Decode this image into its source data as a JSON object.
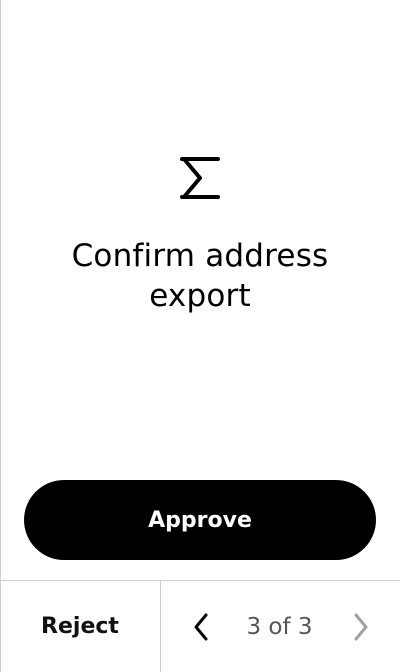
{
  "screen": {
    "app_icon": "sigma-icon",
    "title": "Confirm address export"
  },
  "actions": {
    "approve_label": "Approve"
  },
  "footer": {
    "reject_label": "Reject",
    "pager": {
      "text": "3 of 3",
      "current_page": 3,
      "total_pages": 3,
      "prev_icon": "chevron-left-icon",
      "next_icon": "chevron-right-icon",
      "next_enabled": false
    }
  },
  "colors": {
    "background": "#ffffff",
    "primary": "#000000",
    "divider": "#cfcfcf",
    "muted_text": "#555555",
    "disabled_icon": "#a0a0a0"
  }
}
